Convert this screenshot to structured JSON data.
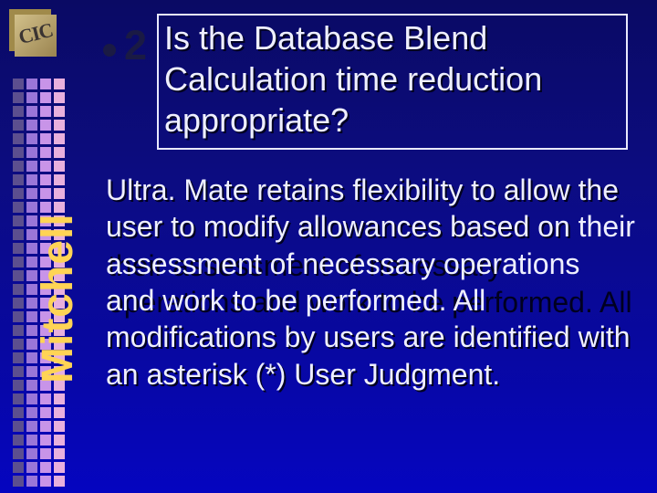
{
  "logo": {
    "text": "CIC"
  },
  "side_title": "Mitchell",
  "number": "2",
  "title": "Is the Database Blend Calculation time reduction appropriate?",
  "body": "Ultra. Mate retains flexibility to allow the user to modify allowances based on their assessment of necessary operations and work to be performed. All modifications by users are identified with an asterisk (*) User Judgment."
}
